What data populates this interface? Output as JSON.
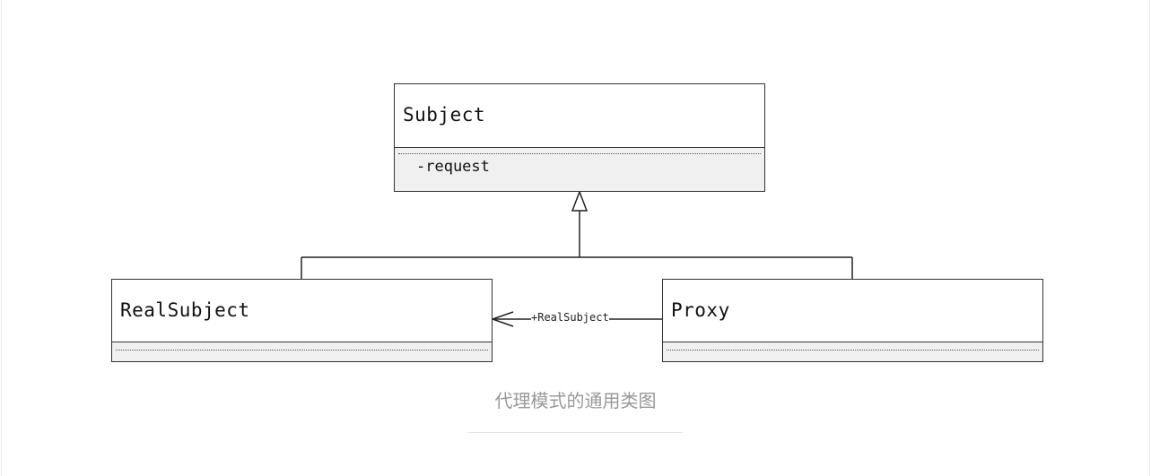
{
  "diagram": {
    "classes": [
      {
        "name": "Subject",
        "operations": [
          "-request"
        ]
      },
      {
        "name": "RealSubject",
        "operations": []
      },
      {
        "name": "Proxy",
        "operations": []
      }
    ],
    "association_label": "+RealSubject",
    "caption": "代理模式的通用类图"
  }
}
